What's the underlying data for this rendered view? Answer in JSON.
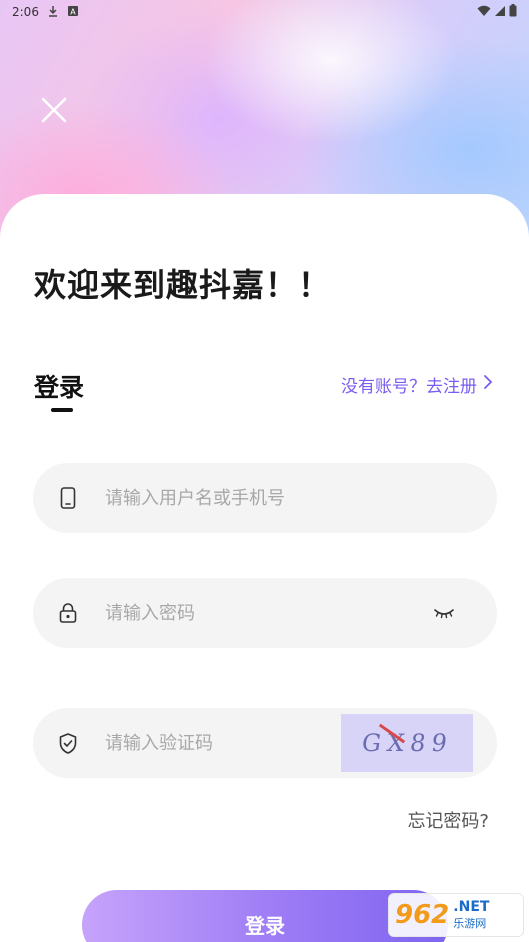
{
  "status_bar": {
    "time": "2:06",
    "icons": [
      "download-icon",
      "notification-a-icon",
      "wifi-icon",
      "signal-icon",
      "battery-icon"
    ]
  },
  "close_icon": "close-icon",
  "welcome_title": "欢迎来到趣抖嘉！！",
  "login_tab": {
    "label": "登录",
    "register_link": "没有账号？去注册"
  },
  "fields": {
    "username": {
      "placeholder": "请输入用户名或手机号",
      "value": "",
      "icon": "phone-icon"
    },
    "password": {
      "placeholder": "请输入密码",
      "value": "",
      "icon": "lock-icon",
      "toggle_icon": "eye-closed-icon"
    },
    "captcha": {
      "placeholder": "请输入验证码",
      "value": "",
      "icon": "shield-check-icon",
      "image_text": "GX89"
    }
  },
  "forgot_password": "忘记密码?",
  "login_button": "登录",
  "watermark": {
    "number": "962",
    "net": ".NET",
    "cn": "乐游网"
  },
  "colors": {
    "accent": "#7b5cf0",
    "button_gradient_start": "#c6a3fb",
    "button_gradient_end": "#7e64f0",
    "field_bg": "#f4f4f4"
  }
}
